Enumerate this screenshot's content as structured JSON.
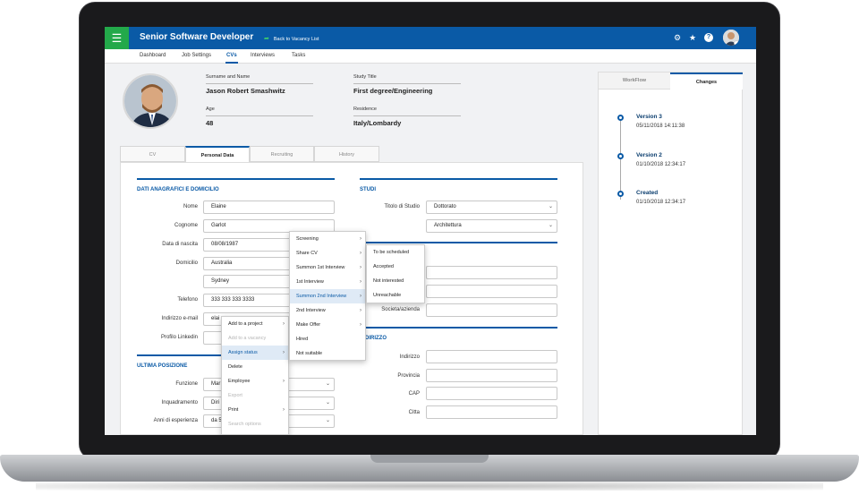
{
  "header": {
    "menu_icon": "hamburger-icon",
    "title": "Senior Software Developer",
    "back_label": "Back to Vacancy List",
    "icons": [
      "gear-icon",
      "star-icon",
      "help-icon",
      "user-avatar-icon"
    ]
  },
  "nav_tabs": [
    "Dashboard",
    "Job Settings",
    "CVs",
    "Interviews",
    "Tasks"
  ],
  "active_nav_tab": "CVs",
  "candidate": {
    "surname_label": "Surname and Name",
    "surname_value": "Jason Robert Smashwitz",
    "study_label": "Study Title",
    "study_value": "First degree/Engineering",
    "age_label": "Age",
    "age_value": "48",
    "residence_label": "Residence",
    "residence_value": "Italy/Lombardy"
  },
  "sub_tabs": [
    "CV",
    "Personal Data",
    "Recruiting",
    "History"
  ],
  "active_sub_tab": "Personal Data",
  "personal": {
    "section_title": "DATI ANAGRAFICI E DOMICILIO",
    "nome_label": "Nome",
    "nome_value": "Elaine",
    "cognome_label": "Cognome",
    "cognome_value": "Garlot",
    "nascita_label": "Data di nascita",
    "nascita_value": "08/08/1987",
    "domicilio_label": "Domicilio",
    "domicilio_value": "Australia",
    "domicilio_city": "Sydney",
    "telefono_label": "Telefono",
    "telefono_value": "333 333 333 3333",
    "email_label": "Indirizzo e-mail",
    "email_value": "elai",
    "linkedin_label": "Profilo Linkedin",
    "linkedin_value": ""
  },
  "position": {
    "section_title": "ULTIMA POSIZIONE",
    "funzione_label": "Funzione",
    "funzione_value": "Mar",
    "inquadramento_label": "Inquadramento",
    "inquadramento_value": "Diri",
    "anni_label": "Anni di esperienza",
    "anni_value": "da 5"
  },
  "studi": {
    "section_title": "STUDI",
    "titolo_label": "Titolo di Studio",
    "titolo_value": "Dottorato",
    "indirizzo_value": "Architettura",
    "societa_label": "Societa/azienda"
  },
  "address": {
    "section_title": "INDIRIZZO",
    "indirizzo_label": "Indirizzo",
    "provincia_label": "Provincia",
    "cap_label": "CAP",
    "citta_label": "Citta"
  },
  "right_panel": {
    "tabs": [
      "WorkFlow",
      "Changes"
    ],
    "active_tab": "Changes",
    "timeline": [
      {
        "title": "Version 3",
        "date": "05/11/2018 14:11:38"
      },
      {
        "title": "Version 2",
        "date": "01/10/2018 12:34:17"
      },
      {
        "title": "Created",
        "date": "01/10/2018 12:34:17"
      }
    ]
  },
  "context_menu": {
    "items": [
      {
        "label": "Add to a project",
        "submenu": true,
        "disabled": false
      },
      {
        "label": "Add to a vacancy",
        "submenu": false,
        "disabled": true
      },
      {
        "label": "Assign status",
        "submenu": true,
        "disabled": false,
        "active": true
      },
      {
        "label": "Delete",
        "submenu": false,
        "disabled": false
      },
      {
        "label": "Employee",
        "submenu": true,
        "disabled": false
      },
      {
        "label": "Export",
        "submenu": false,
        "disabled": true
      },
      {
        "label": "Print",
        "submenu": true,
        "disabled": false
      },
      {
        "label": "Search options",
        "submenu": false,
        "disabled": true
      }
    ]
  },
  "status_menu": {
    "items": [
      {
        "label": "Screening",
        "submenu": true
      },
      {
        "label": "Share CV",
        "submenu": true
      },
      {
        "label": "Summon 1st Interview",
        "submenu": true
      },
      {
        "label": "1st Interview",
        "submenu": true
      },
      {
        "label": "Summon 2nd Interview",
        "submenu": true,
        "active": true
      },
      {
        "label": "2nd Interview",
        "submenu": true
      },
      {
        "label": "Make Offer",
        "submenu": true
      },
      {
        "label": "Hired",
        "submenu": false
      },
      {
        "label": "Not suitable",
        "submenu": false
      }
    ]
  },
  "summon_menu": {
    "items": [
      "To be scheduled",
      "Accepted",
      "Not interested",
      "Unreachable"
    ]
  },
  "colors": {
    "primary": "#0a5aa6",
    "menu_green": "#23a94a"
  }
}
